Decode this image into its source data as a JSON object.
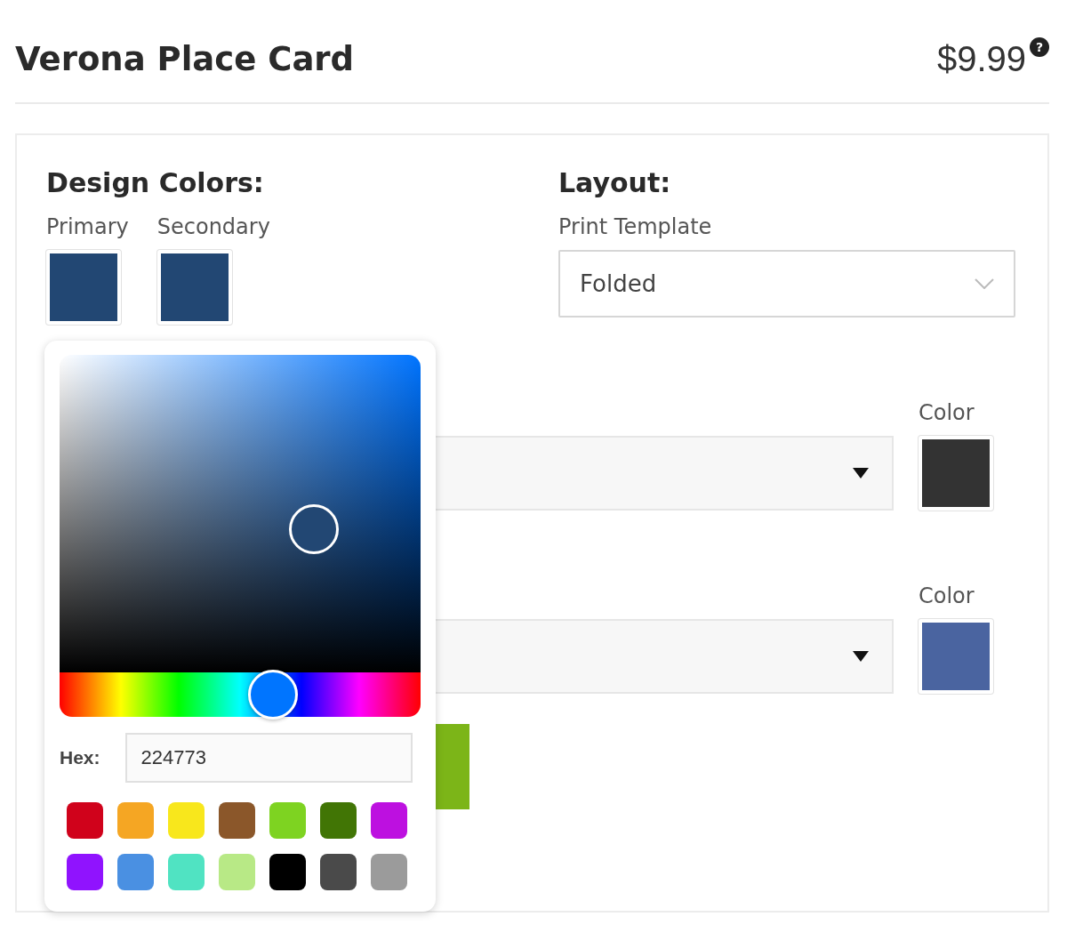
{
  "product": {
    "title": "Verona Place Card",
    "price": "$9.99",
    "help_icon": "?"
  },
  "design_colors": {
    "heading": "Design Colors:",
    "swatches": [
      {
        "label": "Primary",
        "color": "#224773"
      },
      {
        "label": "Secondary",
        "color": "#224773"
      }
    ]
  },
  "layout": {
    "heading": "Layout:",
    "label": "Print Template",
    "value": "Folded"
  },
  "options": [
    {
      "color_label": "Color",
      "color": "#333333"
    },
    {
      "color_label": "Color",
      "color": "#4a64a0"
    }
  ],
  "color_picker": {
    "hue": {
      "level": 0.59
    },
    "hex_label": "Hex:",
    "hex": "224773",
    "presets": [
      {
        "color": "#d0021b"
      },
      {
        "color": "#f5a623"
      },
      {
        "color": "#f8e71c"
      },
      {
        "color": "#8b572a"
      },
      {
        "color": "#7ed321"
      },
      {
        "color": "#417505"
      },
      {
        "color": "#bd10e0"
      },
      {
        "color": "#9013fe"
      },
      {
        "color": "#4a90e2"
      },
      {
        "color": "#50e3c2"
      },
      {
        "color": "#b8e986"
      },
      {
        "color": "#000000"
      },
      {
        "color": "#4a4a4a"
      },
      {
        "color": "#9b9b9b"
      }
    ]
  }
}
